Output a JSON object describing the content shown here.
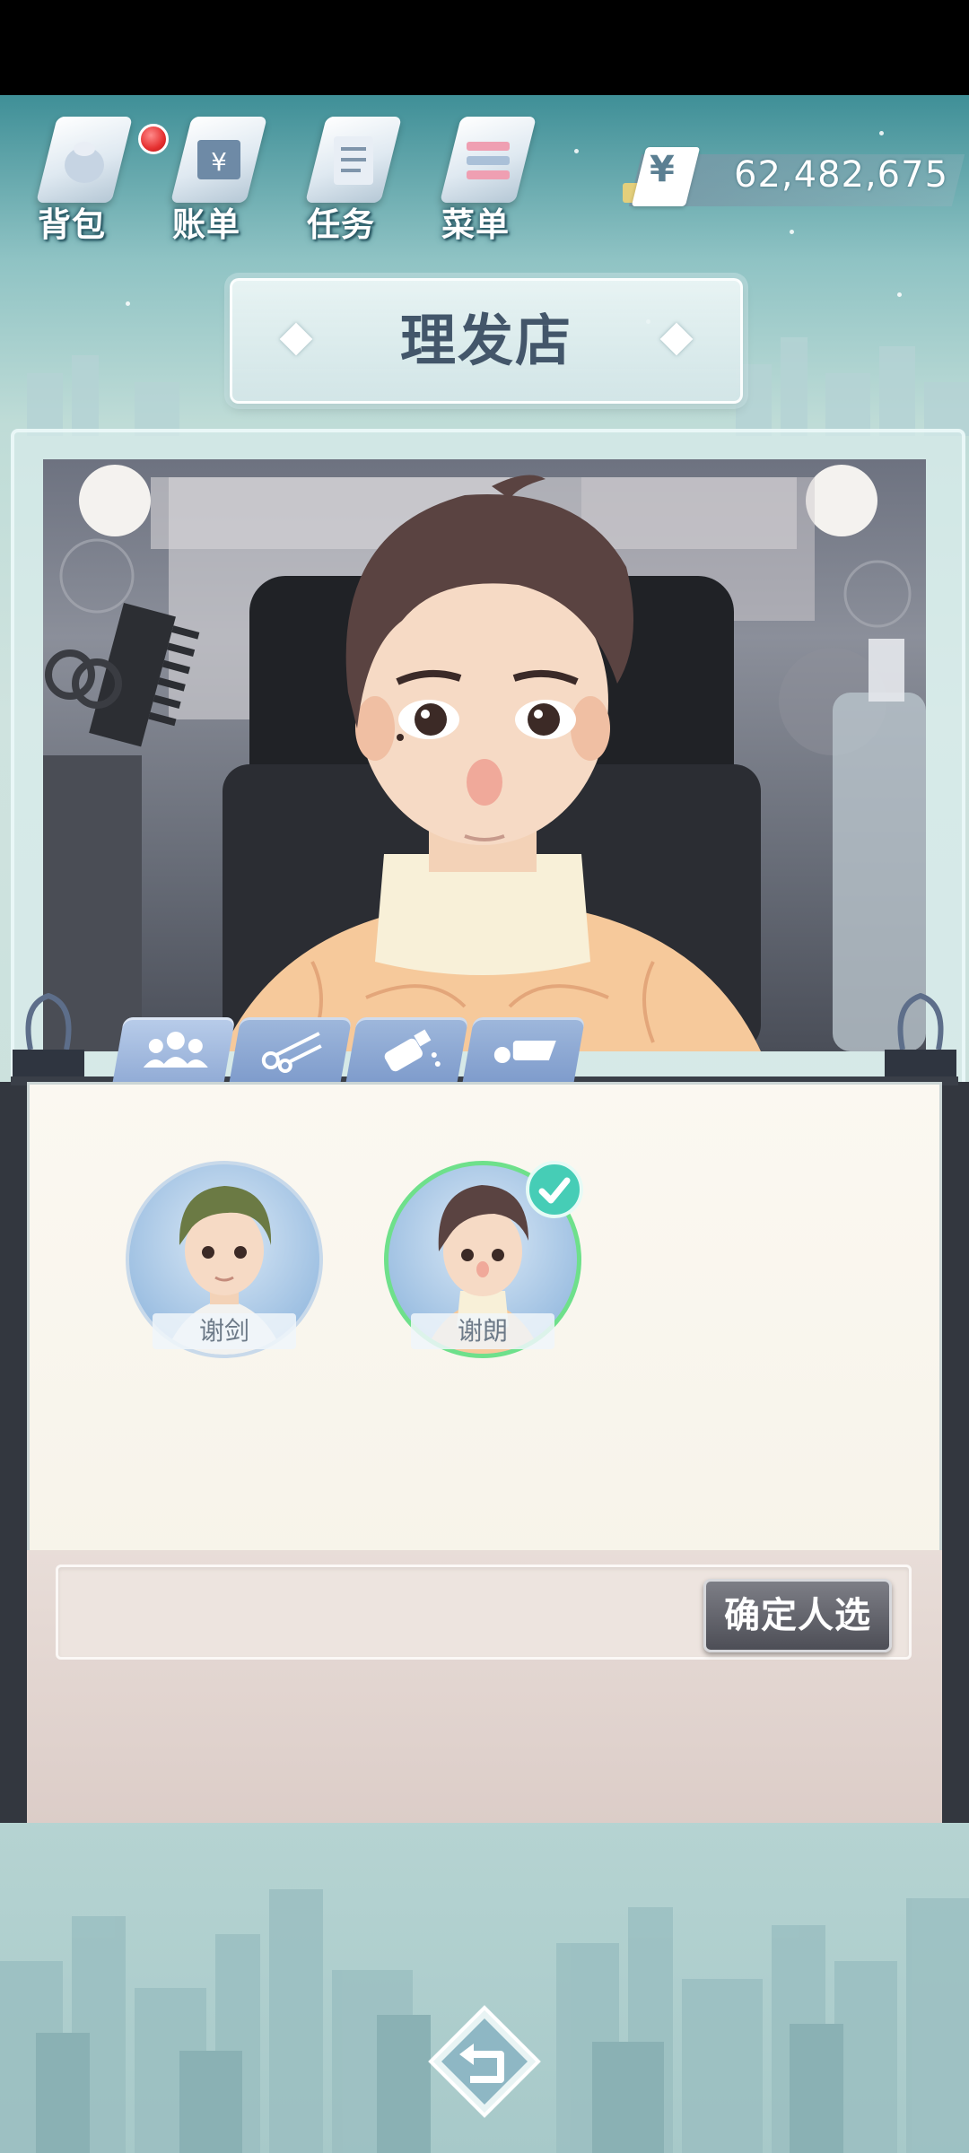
{
  "nav": {
    "items": [
      {
        "label": "背包",
        "icon": "backpack-icon"
      },
      {
        "label": "账单",
        "icon": "bill-icon"
      },
      {
        "label": "任务",
        "icon": "task-icon"
      },
      {
        "label": "菜单",
        "icon": "menu-icon"
      }
    ],
    "money": "62,482,675",
    "currency_symbol": "¥"
  },
  "title": "理发店",
  "tabs": [
    {
      "icon": "people-icon",
      "active": true
    },
    {
      "icon": "scissors-icon",
      "active": false
    },
    {
      "icon": "spray-bottle-icon",
      "active": false
    },
    {
      "icon": "eraser-icon",
      "active": false
    }
  ],
  "candidates": [
    {
      "name": "谢剑",
      "selected": false
    },
    {
      "name": "谢朗",
      "selected": true
    }
  ],
  "confirm_label": "确定人选",
  "colors": {
    "accent_green": "#6ee08b",
    "tab_blue": "#8fa9d4",
    "button_gray": "#5b5c64"
  }
}
